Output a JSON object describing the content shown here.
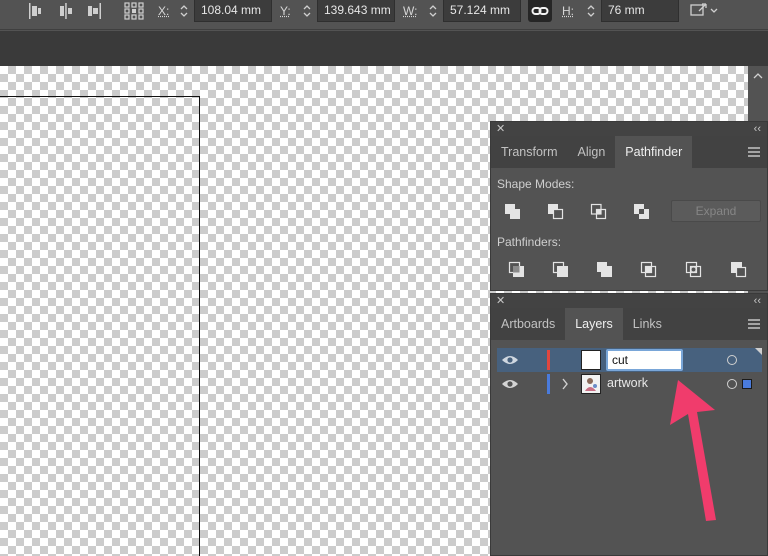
{
  "control_bar": {
    "x_label": "X:",
    "x_value": "108.04 mm",
    "y_label": "Y:",
    "y_value": "139.643 mm",
    "w_label": "W:",
    "w_value": "57.124 mm",
    "h_label": "H:",
    "h_value": "76 mm"
  },
  "pathfinder_panel": {
    "tabs": [
      "Transform",
      "Align",
      "Pathfinder"
    ],
    "active_tab": "Pathfinder",
    "shape_modes_label": "Shape Modes:",
    "expand_label": "Expand",
    "pathfinders_label": "Pathfinders:"
  },
  "layers_panel": {
    "tabs": [
      "Artboards",
      "Layers",
      "Links"
    ],
    "active_tab": "Layers",
    "layers": [
      {
        "name": "cut",
        "color": "#e0463f",
        "editing": true,
        "selected": true
      },
      {
        "name": "artwork",
        "color": "#4a7bdc",
        "editing": false,
        "selected": false
      }
    ]
  },
  "colors": {
    "selection_row": "#47617e",
    "annotation_arrow": "#f03c6c",
    "ui_background": "#535353"
  }
}
